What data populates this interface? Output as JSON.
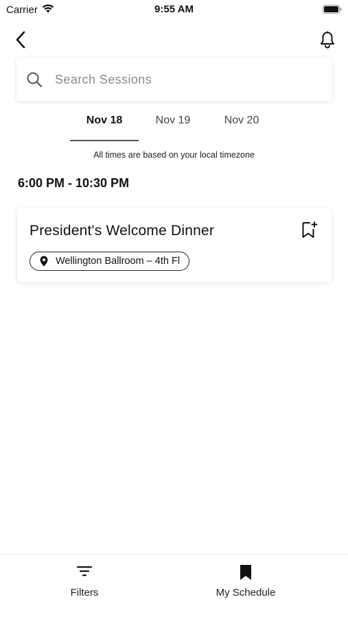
{
  "status_bar": {
    "carrier": "Carrier",
    "time": "9:55 AM",
    "wifi_icon": "wifi-icon",
    "battery_icon": "battery-icon"
  },
  "nav": {
    "back_icon": "chevron-left-icon",
    "notifications_icon": "bell-icon"
  },
  "search": {
    "placeholder": "Search Sessions",
    "value": ""
  },
  "date_tabs": [
    {
      "label": "Nov 18",
      "active": true
    },
    {
      "label": "Nov 19",
      "active": false
    },
    {
      "label": "Nov 20",
      "active": false
    }
  ],
  "timezone_note": "All times are based on your local timezone",
  "sessions": [
    {
      "time_range": "6:00 PM - 10:30 PM",
      "title": "President's Welcome Dinner",
      "location": "Wellington Ballroom – 4th Fl",
      "bookmark_icon": "bookmark-add-icon"
    }
  ],
  "tab_bar": {
    "items": [
      {
        "label": "Filters",
        "icon": "filter-icon"
      },
      {
        "label": "My Schedule",
        "icon": "bookmark-icon"
      }
    ]
  },
  "colors": {
    "text": "#111111",
    "muted": "#8a8a8a",
    "background": "#ffffff",
    "tab_indicator": "#555555"
  }
}
